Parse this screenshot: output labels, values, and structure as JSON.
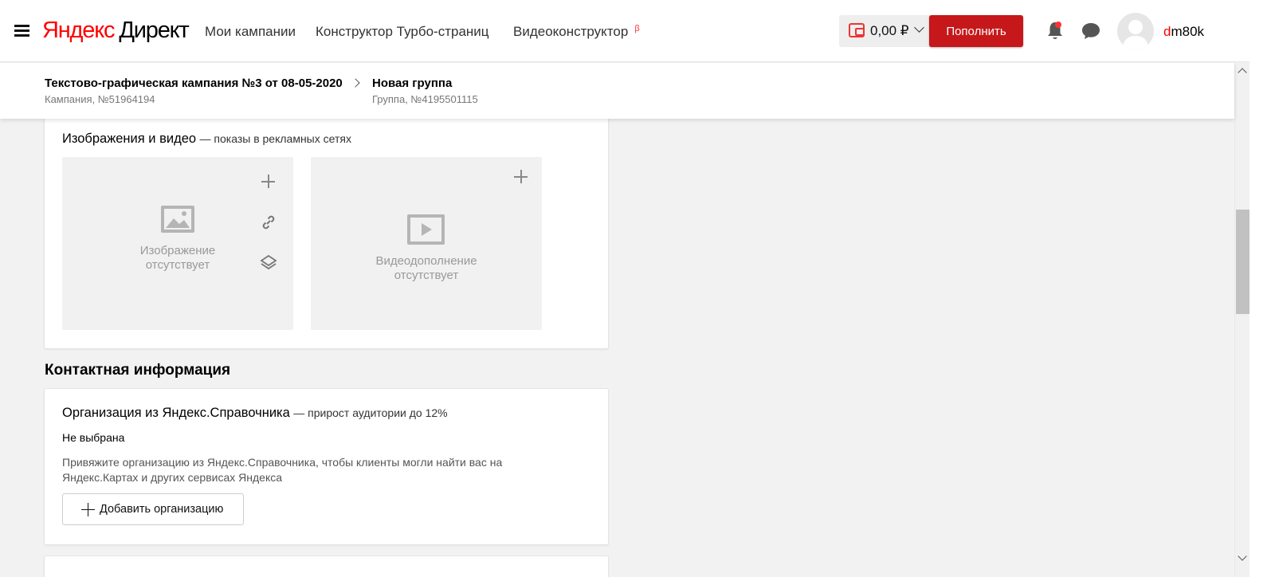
{
  "header": {
    "logo_part1": "Яндекс",
    "logo_part2": "Директ",
    "nav": [
      {
        "label": "Мои кампании"
      },
      {
        "label": "Конструктор Турбо-страниц"
      },
      {
        "label": "Видеоконструктор",
        "badge": "β"
      }
    ],
    "balance": "0,00 ₽",
    "topup_label": "Пополнить",
    "user_first_letter": "d",
    "user_rest": "m80k",
    "colors": {
      "accent": "#c6181a",
      "brand_red": "#ff0000"
    }
  },
  "breadcrumb": {
    "campaign_title": "Текстово-графическая кампания №3 от 08-05-2020",
    "campaign_sub": "Кампания, №51964194",
    "group_title": "Новая группа",
    "group_sub": "Группа, №4195501115"
  },
  "media": {
    "title": "Изображения и видео",
    "hint": "— показы в рекламных сетях",
    "image_empty_line1": "Изображение",
    "image_empty_line2": "отсутствует",
    "video_empty_line1": "Видеодополнение",
    "video_empty_line2": "отсутствует",
    "icons": [
      "image-icon",
      "plus-icon",
      "link-icon",
      "layers-icon",
      "video-icon"
    ]
  },
  "contact": {
    "heading": "Контактная информация",
    "org_title": "Организация из Яндекс.Справочника",
    "org_hint": "— прирост аудитории до 12%",
    "org_status": "Не выбрана",
    "org_desc": "Привяжите организацию из Яндекс.Справочника, чтобы клиенты могли найти вас на Яндекс.Картах и других сервисах Яндекса",
    "add_org_label": "Добавить организацию"
  }
}
